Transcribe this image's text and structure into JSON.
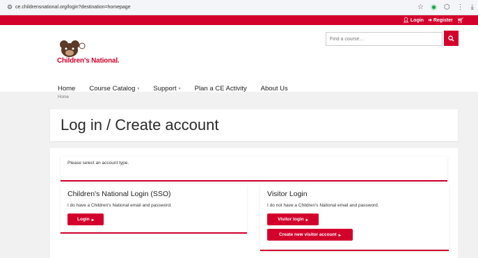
{
  "browser": {
    "url": "ce.childrensnational.org/login?destination=homepage",
    "icons": [
      "tune-icon",
      "star-icon",
      "extension-icon",
      "puzzle-icon",
      "menu-icon",
      "download-icon"
    ]
  },
  "top_bar": {
    "login_label": "Login",
    "register_label": "Register",
    "accent": "#d4002c"
  },
  "header": {
    "logo_text": "Children's National.",
    "search_placeholder": "Find a course..."
  },
  "nav": {
    "items": [
      {
        "label": "Home",
        "has_caret": false
      },
      {
        "label": "Course Catalog",
        "has_caret": true
      },
      {
        "label": "Support",
        "has_caret": true
      },
      {
        "label": "Plan a CE Activity",
        "has_caret": false
      },
      {
        "label": "About Us",
        "has_caret": false
      }
    ]
  },
  "breadcrumb": "Home",
  "page": {
    "title": "Log in / Create account",
    "select_prompt": "Please select an account type."
  },
  "sso": {
    "heading": "Children's National Login (SSO)",
    "description": "I do have a Children's National email and password.",
    "login_button": "Login"
  },
  "visitor": {
    "heading": "Visitor Login",
    "description": "I do not have a Children's National email and password.",
    "login_button": "Visitor login",
    "create_button": "Create new visitor account"
  }
}
